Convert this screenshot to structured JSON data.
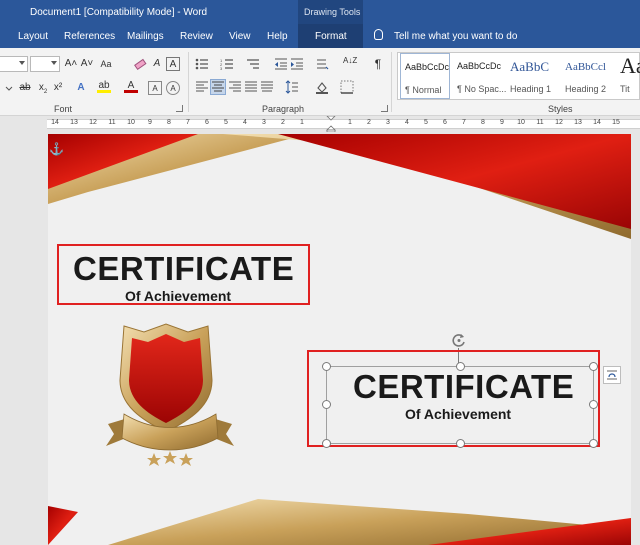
{
  "titlebar": {
    "document_title": "Document1 [Compatibility Mode]  -  Word",
    "context_group": "Drawing Tools"
  },
  "tabs": [
    {
      "label": "Layout"
    },
    {
      "label": "References"
    },
    {
      "label": "Mailings"
    },
    {
      "label": "Review"
    },
    {
      "label": "View"
    },
    {
      "label": "Help"
    },
    {
      "label": "Format",
      "active": true
    }
  ],
  "tell_me": "Tell me what you want to do",
  "ribbon": {
    "groups": {
      "font": "Font",
      "paragraph": "Paragraph",
      "styles": "Styles"
    },
    "font_glyphs": {
      "grow": "A˄",
      "shrink": "A˅",
      "change_case": "Aa",
      "clear": "A",
      "text_effects": "A",
      "subscript_letter": "x",
      "subscript_digit": "2",
      "superscript": "x²",
      "highlight": "ab",
      "font_color": "A"
    },
    "pilcrow": "¶",
    "sort": "A↓Z",
    "styles": [
      {
        "sample": "AaBbCcDc",
        "name": "¶ Normal"
      },
      {
        "sample": "AaBbCcDc",
        "name": "¶ No Spac..."
      },
      {
        "sample": "AaBbC",
        "name": "Heading 1"
      },
      {
        "sample": "AaBbCcl",
        "name": "Heading 2"
      },
      {
        "sample": "Aa",
        "name": "Tit"
      }
    ]
  },
  "ruler_numbers": [
    "14",
    "13",
    "12",
    "11",
    "10",
    "9",
    "8",
    "7",
    "6",
    "5",
    "4",
    "3",
    "2",
    "1",
    "1",
    "2",
    "3",
    "4",
    "5",
    "6",
    "7",
    "8",
    "9",
    "10",
    "11",
    "12",
    "13",
    "14",
    "15"
  ],
  "certificates": [
    {
      "title": "CERTIFICATE",
      "subtitle": "Of Achievement"
    },
    {
      "title": "CERTIFICATE",
      "subtitle": "Of Achievement"
    }
  ],
  "colors": {
    "word_blue": "#2b579a",
    "accent_red": "#c8100c",
    "gold": "#c9a15a",
    "selection_red": "#e02020"
  },
  "icons": [
    "anchor-icon",
    "lightbulb-icon",
    "rotate-handle-icon",
    "layout-options-icon",
    "shield-trophy-icon",
    "star-icon"
  ]
}
